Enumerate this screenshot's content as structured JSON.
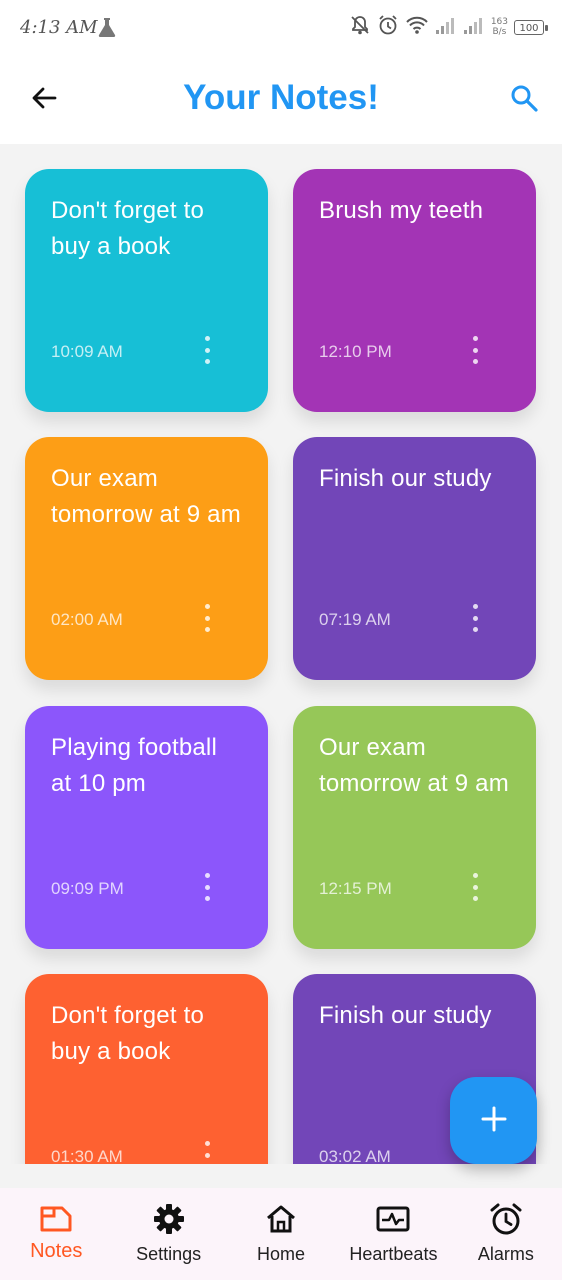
{
  "status_bar": {
    "time": "4:13 AM",
    "net_speed_top": "163",
    "net_speed_bottom": "B/s",
    "battery": "100"
  },
  "app_bar": {
    "title": "Your Notes!",
    "back_icon": "arrow-left-icon",
    "search_icon": "search-icon",
    "accent_color": "#2196f3"
  },
  "notes": [
    {
      "title": "Don't forget to buy a book",
      "time": "10:09 AM",
      "color": "#17bfd6"
    },
    {
      "title": "Brush my teeth",
      "time": "12:10 PM",
      "color": "#a334b5"
    },
    {
      "title": "Our exam tomorrow at 9 am",
      "time": "02:00 AM",
      "color": "#fd9e16"
    },
    {
      "title": "Finish our study",
      "time": "07:19 AM",
      "color": "#7246b8"
    },
    {
      "title": "Playing football at 10 pm",
      "time": "09:09 PM",
      "color": "#8c56fb"
    },
    {
      "title": "Our exam tomorrow at 9 am",
      "time": "12:15 PM",
      "color": "#96c758"
    },
    {
      "title": "Don't forget to buy a book",
      "time": "01:30 AM",
      "color": "#fe6131"
    },
    {
      "title": "Finish our study",
      "time": "03:02 AM",
      "color": "#7246b8"
    }
  ],
  "fab": {
    "icon": "plus-icon",
    "color": "#2196f3"
  },
  "bottom_nav": {
    "active_color": "#ff5722",
    "items": [
      {
        "label": "Notes",
        "icon": "note-icon"
      },
      {
        "label": "Settings",
        "icon": "gear-icon"
      },
      {
        "label": "Home",
        "icon": "home-icon"
      },
      {
        "label": "Heartbeats",
        "icon": "heartbeat-icon"
      },
      {
        "label": "Alarms",
        "icon": "alarm-clock-icon"
      }
    ]
  }
}
